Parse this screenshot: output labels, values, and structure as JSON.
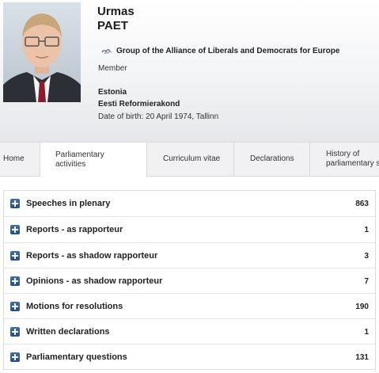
{
  "profile": {
    "first_name": "Urmas",
    "last_name": "PAET",
    "group_name": "Group of the Alliance of Liberals and Democrats for Europe",
    "group_icon": "birds-icon",
    "role": "Member",
    "country": "Estonia",
    "party": "Eesti Reformierakond",
    "date_of_birth": "Date of birth: 20 April 1974, Tallinn"
  },
  "tabs": [
    {
      "label": "Home"
    },
    {
      "label_line1": "Parliamentary",
      "label_line2": "activities",
      "active": true
    },
    {
      "label": "Curriculum vitae"
    },
    {
      "label": "Declarations"
    },
    {
      "label_line1": "History of",
      "label_line2": "parliamentary s"
    }
  ],
  "activities": [
    {
      "label": "Speeches in plenary",
      "count": "863"
    },
    {
      "label": "Reports - as rapporteur",
      "count": "1"
    },
    {
      "label": "Reports - as shadow rapporteur",
      "count": "3"
    },
    {
      "label": "Opinions - as shadow rapporteur",
      "count": "7"
    },
    {
      "label": "Motions for resolutions",
      "count": "190"
    },
    {
      "label": "Written declarations",
      "count": "1"
    },
    {
      "label": "Parliamentary questions",
      "count": "131"
    }
  ],
  "colors": {
    "expand_icon": "#2a5a9d",
    "tab_bar": "#f1f1f3",
    "header_gradient_end": "#e6e7ea"
  }
}
